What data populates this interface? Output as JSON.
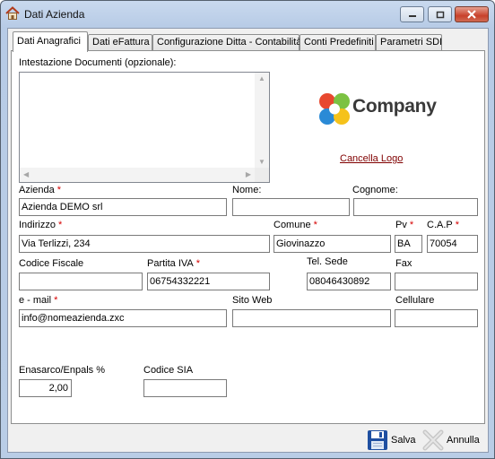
{
  "window": {
    "title": "Dati Azienda",
    "icon": "home-icon",
    "controls": [
      "minimize-icon",
      "maximize-icon",
      "close-icon"
    ]
  },
  "tabs": [
    {
      "label": "Dati Anagrafici",
      "active": true
    },
    {
      "label": "Dati eFattura",
      "active": false
    },
    {
      "label": "Configurazione Ditta - Contabilità",
      "active": false
    },
    {
      "label": "Conti Predefiniti",
      "active": false
    },
    {
      "label": "Parametri SDI",
      "active": false
    }
  ],
  "header_doc": {
    "label": "Intestazione Documenti (opzionale):",
    "value": ""
  },
  "logo": {
    "text": "Company",
    "remove_link": "Cancella Logo"
  },
  "fields": {
    "azienda": {
      "label": "Azienda",
      "required": "*",
      "value": "Azienda DEMO srl"
    },
    "nome": {
      "label": "Nome:",
      "value": ""
    },
    "cognome": {
      "label": "Cognome:",
      "value": ""
    },
    "indirizzo": {
      "label": "Indirizzo",
      "required": "*",
      "value": "Via Terlizzi, 234"
    },
    "comune": {
      "label": "Comune",
      "required": "*",
      "value": "Giovinazzo"
    },
    "pv": {
      "label": "Pv",
      "required": "*",
      "value": "BA"
    },
    "cap": {
      "label": "C.A.P",
      "required": "*",
      "value": "70054"
    },
    "codice_fiscale": {
      "label": "Codice Fiscale",
      "value": ""
    },
    "partita_iva": {
      "label": "Partita IVA",
      "required": "*",
      "value": "06754332221"
    },
    "tel_sede": {
      "label": "Tel. Sede",
      "value": "08046430892"
    },
    "fax": {
      "label": "Fax",
      "value": ""
    },
    "email": {
      "label": "e - mail",
      "required": "*",
      "value": "info@nomeazienda.zxc"
    },
    "sito_web": {
      "label": "Sito Web",
      "value": ""
    },
    "cellulare": {
      "label": "Cellulare",
      "value": ""
    },
    "enasarco": {
      "label": "Enasarco/Enpals %",
      "value": "2,00"
    },
    "codice_sia": {
      "label": "Codice SIA",
      "value": ""
    }
  },
  "actions": {
    "save": {
      "label": "Salva",
      "icon": "floppy-disk-icon"
    },
    "cancel": {
      "label": "Annulla",
      "icon": "x-cancel-icon"
    }
  },
  "colors": {
    "required": "#d60000",
    "link": "#800000"
  }
}
